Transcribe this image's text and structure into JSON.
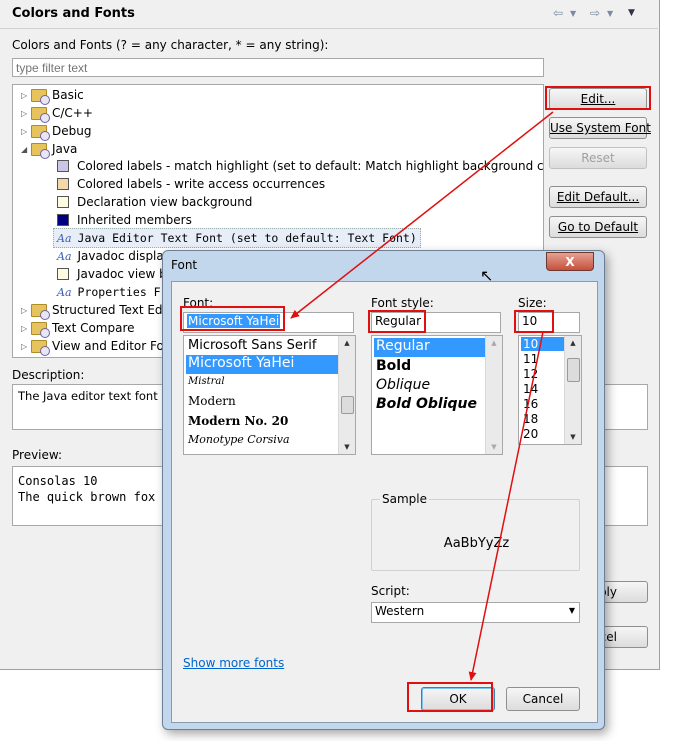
{
  "pref": {
    "title": "Colors and Fonts",
    "nav_icons": [
      "back-arrow-icon",
      "forward-arrow-icon",
      "dropdown-icon"
    ],
    "tree_label": "Colors and Fonts (? = any character, * = any string):",
    "filter_placeholder": "type filter text",
    "tree": {
      "basic": "Basic",
      "cpp": "C/C++",
      "debug": "Debug",
      "java": "Java",
      "java_children": [
        "Colored labels - match highlight (set to default: Match highlight background color)",
        "Colored labels - write access occurrences",
        "Declaration view background",
        "Inherited members",
        "Java Editor Text Font (set to default: Text Font)",
        "Javadoc display f",
        "Javadoc view ba",
        "Properties F"
      ],
      "structured": "Structured Text Edito",
      "text_compare": "Text Compare",
      "view_editor": "View and Editor Fold"
    },
    "swatch_colors": [
      "#c9c6e8",
      "#f3d9a9",
      "#fffde1",
      "#000080"
    ],
    "buttons": {
      "edit": "Edit...",
      "use_system_font": "Use System Font",
      "reset": "Reset",
      "edit_default": "Edit Default...",
      "go_to_default": "Go to Default"
    },
    "description_label": "Description:",
    "description_text": "The Java editor text font is u",
    "preview_label": "Preview:",
    "preview_lines": [
      "Consolas 10",
      "The quick brown fox j"
    ],
    "apply_partial": "ply",
    "cancel_partial": "cel"
  },
  "dialog": {
    "title": "Font",
    "close": "X",
    "font_label": "Font:",
    "font_value": "Microsoft YaHei",
    "fonts": [
      "Microsoft Sans Serif",
      "Microsoft YaHei",
      "Mistral",
      "Modern",
      "Modern No. 20",
      "Monotype Corsiva"
    ],
    "style_label": "Font style:",
    "style_value": "Regular",
    "styles": [
      "Regular",
      "Bold",
      "Oblique",
      "Bold Oblique"
    ],
    "size_label": "Size:",
    "size_value": "10",
    "sizes": [
      "10",
      "11",
      "12",
      "14",
      "16",
      "18",
      "20"
    ],
    "sample_label": "Sample",
    "sample_text": "AaBbYyZz",
    "script_label": "Script:",
    "script_value": "Western",
    "show_more": "Show more fonts",
    "ok": "OK",
    "cancel": "Cancel"
  },
  "annotation_color": "#e01010",
  "selection_color": "#3399ff"
}
